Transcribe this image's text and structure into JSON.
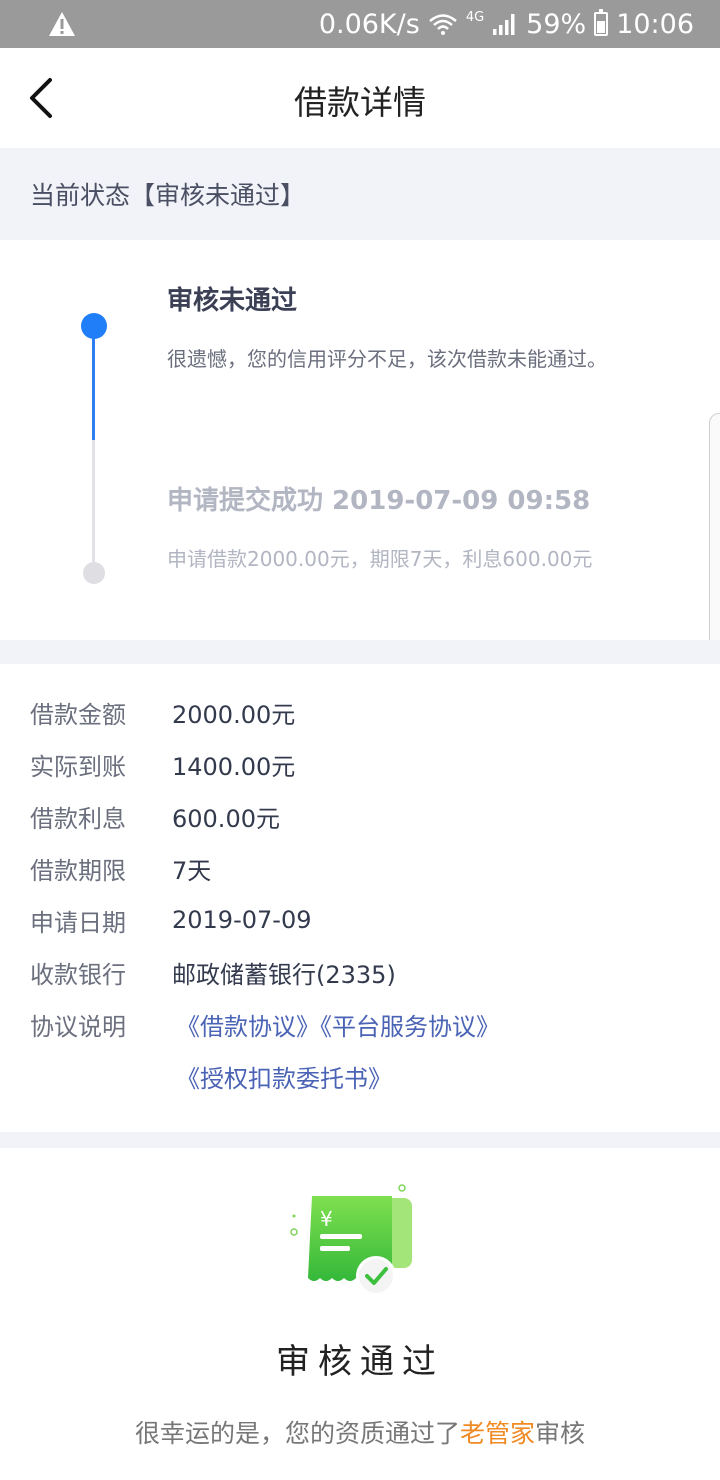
{
  "status_bar": {
    "speed": "0.06K/s",
    "network": "4G",
    "battery": "59%",
    "time": "10:06"
  },
  "nav": {
    "title": "借款详情"
  },
  "current_status": "当前状态【审核未通过】",
  "timeline": [
    {
      "title": "审核未通过",
      "desc": "很遗憾，您的信用评分不足，该次借款未能通过。"
    },
    {
      "title": "申请提交成功 2019-07-09 09:58",
      "desc": "申请借款2000.00元，期限7天，利息600.00元"
    }
  ],
  "details": [
    {
      "label": "借款金额",
      "value": "2000.00元"
    },
    {
      "label": "实际到账",
      "value": "1400.00元"
    },
    {
      "label": "借款利息",
      "value": "600.00元"
    },
    {
      "label": "借款期限",
      "value": "7天"
    },
    {
      "label": "申请日期",
      "value": "2019-07-09"
    },
    {
      "label": "收款银行",
      "value": "邮政储蓄银行(2335)"
    }
  ],
  "agreements": {
    "label": "协议说明",
    "links": [
      "《借款协议》",
      "《平台服务协议》",
      "《授权扣款委托书》"
    ]
  },
  "promo": {
    "title": "审核通过",
    "sub_before": "很幸运的是，您的资质通过了",
    "sub_highlight": "老管家",
    "sub_after": "审核",
    "icon": "receipt-check-icon",
    "currency_symbol": "¥"
  },
  "colors": {
    "accent_blue": "#1f7ef8",
    "link_blue": "#4a63b5",
    "highlight_orange": "#f08a24",
    "green": "#5ccf3c"
  }
}
